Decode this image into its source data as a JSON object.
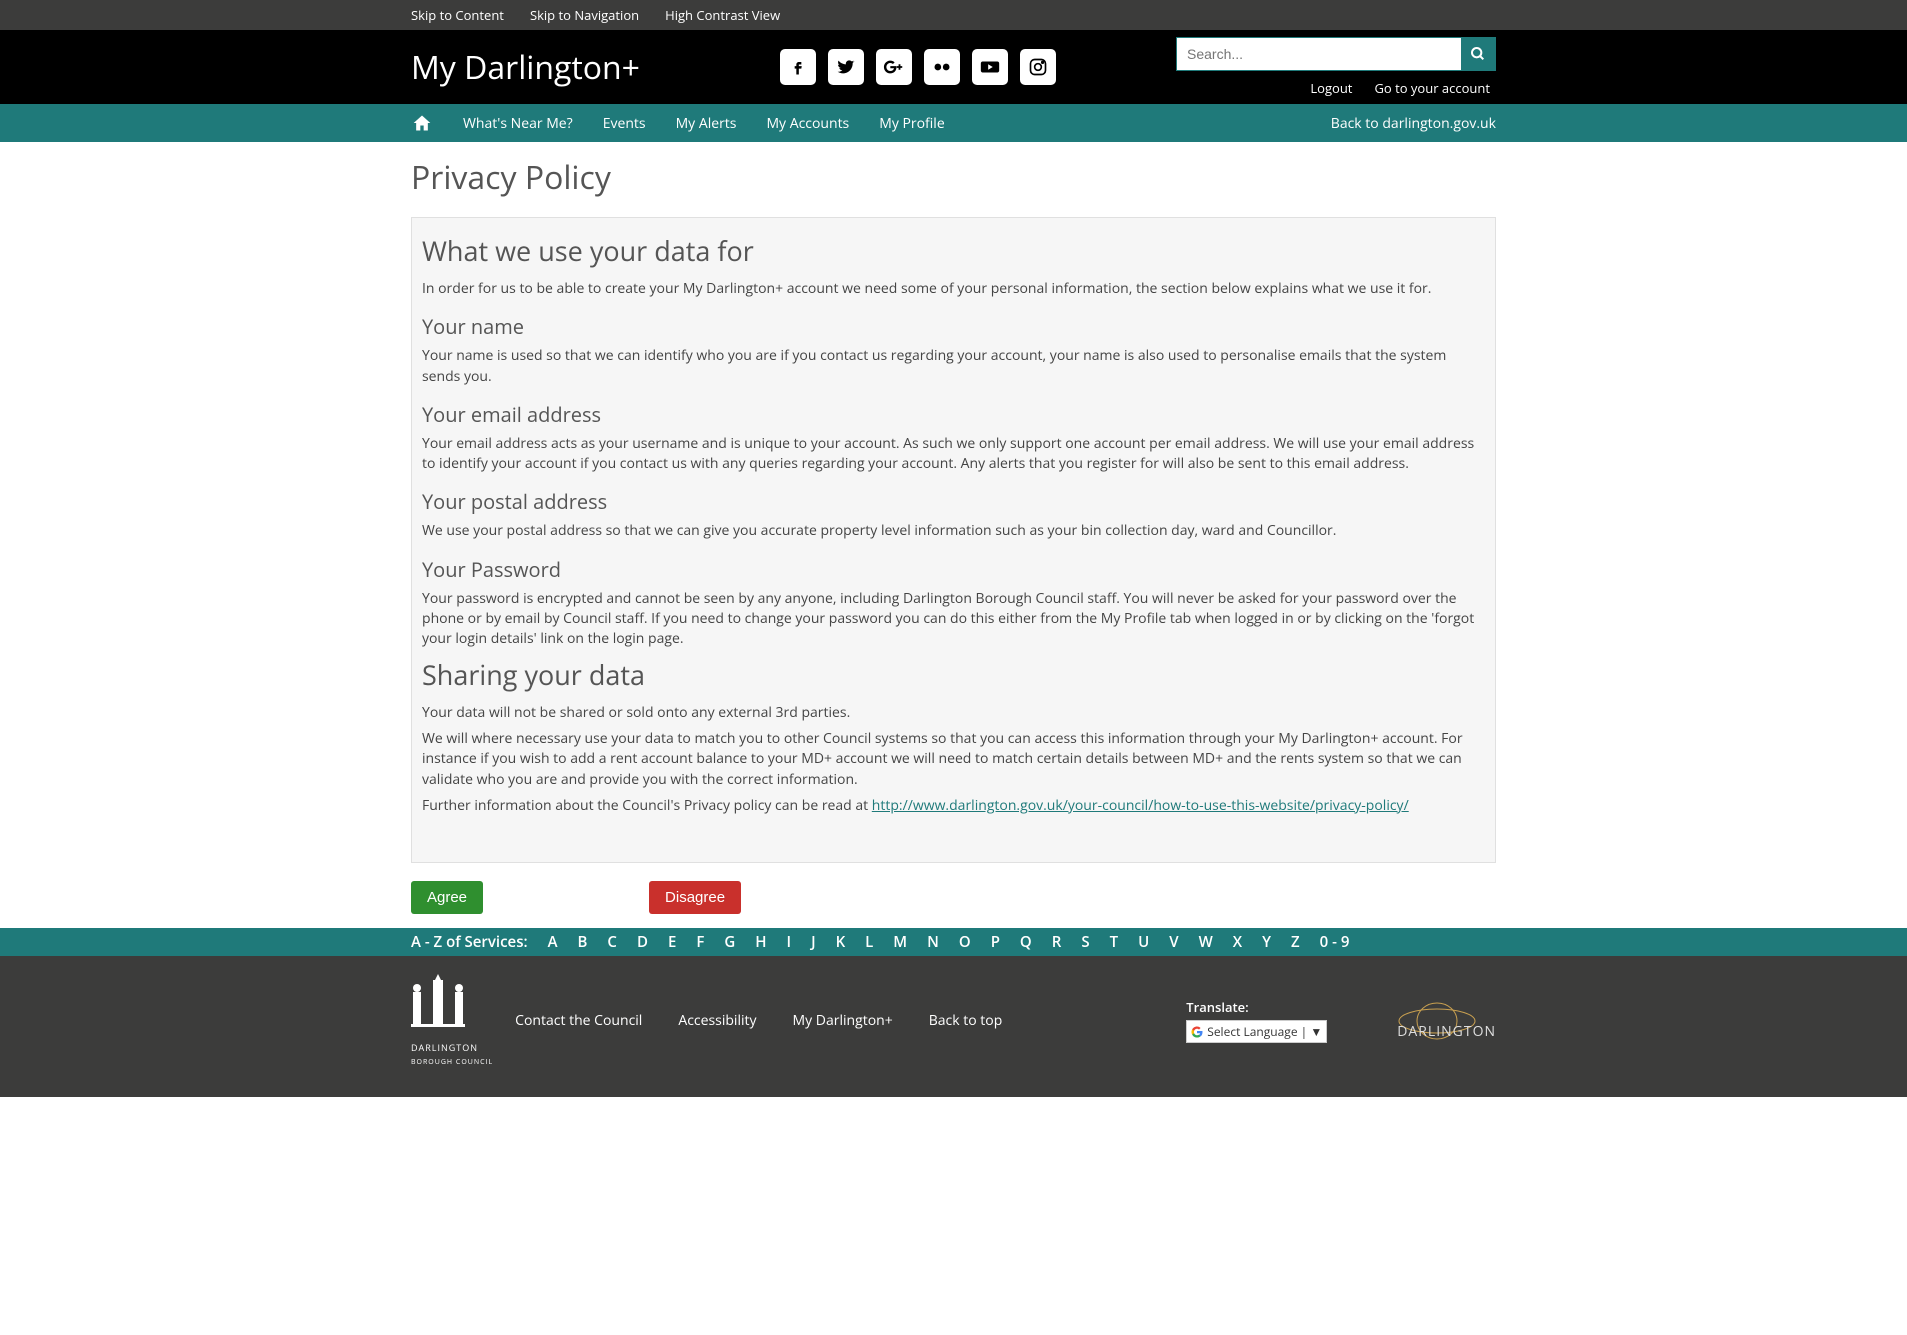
{
  "utility": {
    "skip_content": "Skip to Content",
    "skip_nav": "Skip to Navigation",
    "high_contrast": "High Contrast View"
  },
  "header": {
    "site_title": "My Darlington+",
    "search_placeholder": "Search...",
    "logout": "Logout",
    "go_account": "Go to your account",
    "socials": [
      "facebook",
      "twitter",
      "google-plus",
      "flickr",
      "youtube",
      "instagram"
    ]
  },
  "nav": {
    "items": [
      "What's Near Me?",
      "Events",
      "My Alerts",
      "My Accounts",
      "My Profile"
    ],
    "back_link": "Back to darlington.gov.uk"
  },
  "page": {
    "title": "Privacy Policy",
    "h_whatweuse": "What we use your data for",
    "p_intro": "In order for us to be able to create your My Darlington+ account we need some of your personal information, the section below explains what we use it for.",
    "h_name": "Your name",
    "p_name": "Your name is used so that we can identify who you are if you contact us regarding your account, your name is also used to personalise emails that the system sends you.",
    "h_email": "Your email address",
    "p_email": "Your email address acts as your username and is unique to your account. As such we only support one account per email address. We will use your email address to identify your account if you contact us with any queries regarding your account. Any alerts that you register for will also be sent to this email address.",
    "h_postal": "Your postal address",
    "p_postal": "We use your postal address so that we can give you accurate property level information such as your bin collection day, ward and Councillor.",
    "h_password": "Your Password",
    "p_password": "Your password is encrypted and cannot be seen by any anyone, including Darlington Borough Council staff. You will never be asked for your password over the phone or by email by Council staff. If you need to change your password you can do this either from the My Profile tab when logged in or by clicking on the 'forgot your login details' link on the login page.",
    "h_sharing": "Sharing your data",
    "p_sharing1": "Your data will not be shared or sold onto any external 3rd parties.",
    "p_sharing2": "We will where necessary use your data to match you to other Council systems so that you can access this information through your My Darlington+ account. For instance if you wish to add a rent account balance to your MD+ account we will need to match certain details between MD+ and the rents system so that we can validate who you are and provide you with the correct information.",
    "p_further_prefix": "Further information about the Council's Privacy policy can be read at ",
    "p_further_link": "http://www.darlington.gov.uk/your-council/how-to-use-this-website/privacy-policy/",
    "agree": "Agree",
    "disagree": "Disagree"
  },
  "az": {
    "label": "A - Z of Services:",
    "letters": [
      "A",
      "B",
      "C",
      "D",
      "E",
      "F",
      "G",
      "H",
      "I",
      "J",
      "K",
      "L",
      "M",
      "N",
      "O",
      "P",
      "Q",
      "R",
      "S",
      "T",
      "U",
      "V",
      "W",
      "X",
      "Y",
      "Z",
      "0 - 9"
    ]
  },
  "footer": {
    "links": [
      "Contact the Council",
      "Accessibility",
      "My Darlington+",
      "Back to top"
    ],
    "translate_label": "Translate:",
    "translate_select": "Select Language  | ▼",
    "council_name": "DARLINGTON",
    "council_sub": "BOROUGH COUNCIL",
    "darlington_brand": "DARLINGTON"
  }
}
